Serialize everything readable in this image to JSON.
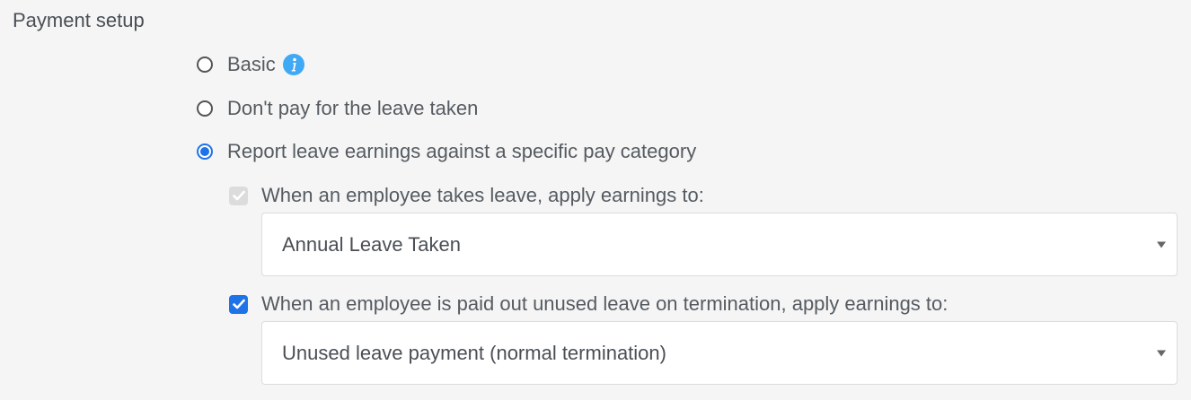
{
  "section": {
    "title": "Payment setup"
  },
  "options": {
    "basic": {
      "label": "Basic",
      "selected": false
    },
    "dont_pay": {
      "label": "Don't pay for the leave taken",
      "selected": false
    },
    "report": {
      "label": "Report leave earnings against a specific pay category",
      "selected": true
    }
  },
  "takes_leave": {
    "checkbox_label": "When an employee takes leave, apply earnings to:",
    "checked": true,
    "disabled": true,
    "select_value": "Annual Leave Taken"
  },
  "termination": {
    "checkbox_label": "When an employee is paid out unused leave on termination, apply earnings to:",
    "checked": true,
    "disabled": false,
    "select_value": "Unused leave payment (normal termination)"
  },
  "colors": {
    "accent": "#1e73e8",
    "info": "#3fa9f5"
  },
  "icons": {
    "info": "info-icon",
    "caret": "chevron-down-icon",
    "check": "check-icon"
  }
}
